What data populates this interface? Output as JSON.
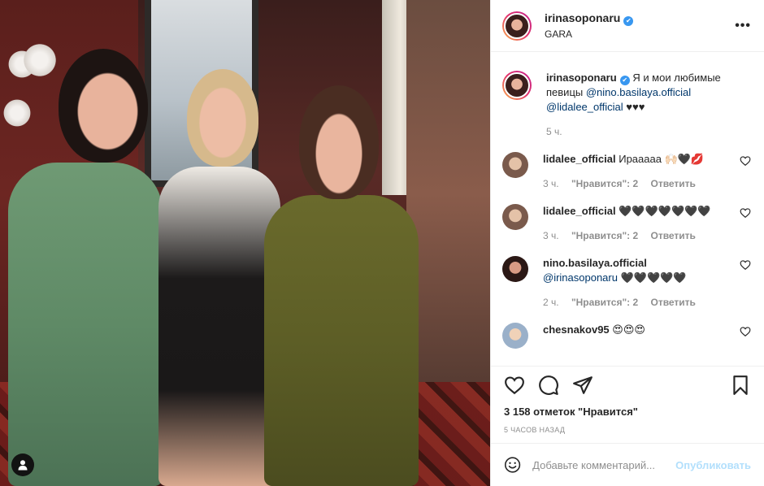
{
  "post": {
    "username": "irinasoponaru",
    "location": "GARA",
    "more_label": "•••"
  },
  "caption": {
    "username": "irinasoponaru",
    "text_before": "Я и мои любимые певицы",
    "mention1": "@nino.basilaya.official",
    "mention2": "@lidalee_official",
    "text_after": "♥♥♥",
    "time": "5 ч."
  },
  "comments": [
    {
      "username": "lidalee_official",
      "text": "Ирааааа 🙌🏻🖤💋",
      "time": "3 ч.",
      "likes": "\"Нравится\": 2",
      "reply": "Ответить"
    },
    {
      "username": "lidalee_official",
      "text": "🖤🖤🖤🖤🖤🖤🖤",
      "time": "3 ч.",
      "likes": "\"Нравится\": 2",
      "reply": "Ответить"
    },
    {
      "username": "nino.basilaya.official",
      "mention": "@irinasoponaru",
      "text": "🖤🖤🖤🖤🖤",
      "time": "2 ч.",
      "likes": "\"Нравится\": 2",
      "reply": "Ответить"
    },
    {
      "username": "chesnakov95",
      "text": "😍😍😍"
    }
  ],
  "actions": {
    "likes_text": "3 158 отметок \"Нравится\"",
    "posted_ago": "5 ЧАСОВ НАЗАД"
  },
  "add_comment": {
    "placeholder": "Добавьте комментарий...",
    "publish_label": "Опубликовать"
  },
  "colors": {
    "link": "#00376b",
    "muted": "#8e8e8e",
    "verified": "#3897f0",
    "publish_disabled": "#b2dffc"
  }
}
